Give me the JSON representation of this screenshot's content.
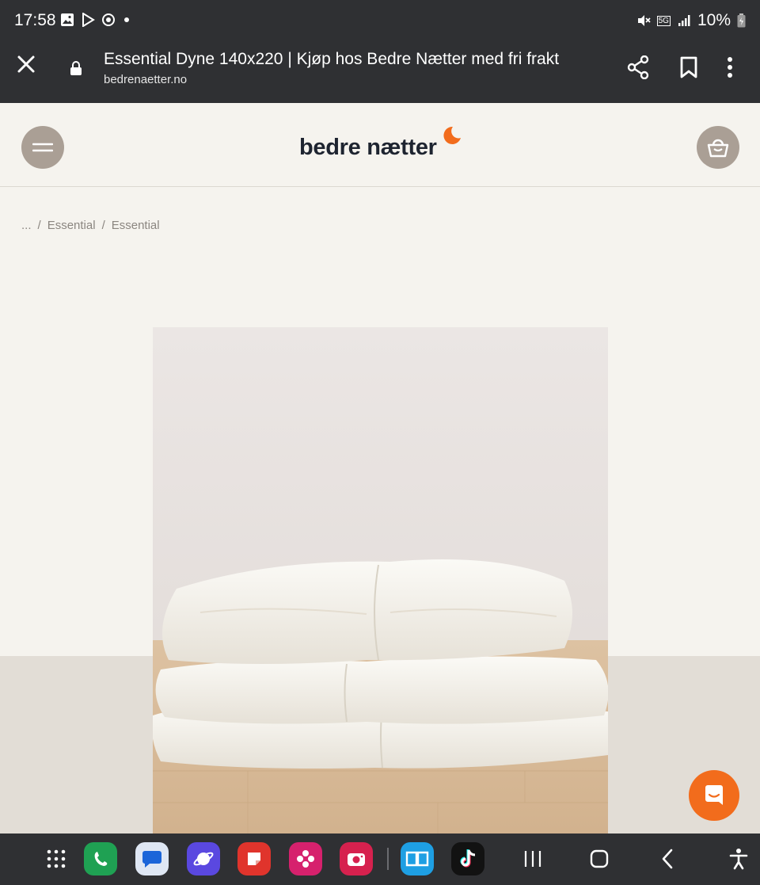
{
  "status_bar": {
    "time": "17:58",
    "battery": "10%",
    "network": "5G"
  },
  "browser": {
    "title": "Essential Dyne 140x220 | Kjøp hos Bedre Nætter med fri frakt",
    "domain": "bedrenaetter.no"
  },
  "site": {
    "logo_text": "bedre nætter",
    "accent_color": "#f26c1c",
    "button_color": "#aa9f95"
  },
  "breadcrumb": {
    "items": [
      "...",
      "Essential",
      "Essential"
    ],
    "separator": "/"
  },
  "product": {
    "image_alt": "white duvet folded"
  },
  "icons": {
    "close": "close-icon",
    "lock": "lock-icon",
    "share": "share-icon",
    "bookmark": "bookmark-icon",
    "more": "more-vertical-icon",
    "menu": "hamburger-menu-icon",
    "cart": "shopping-basket-icon",
    "chat": "chat-icon"
  },
  "taskbar": {
    "apps": [
      "app-drawer",
      "phone",
      "messages",
      "internet",
      "notes",
      "gallery",
      "camera",
      "reader",
      "tiktok"
    ],
    "nav": [
      "recents",
      "home",
      "back",
      "accessibility"
    ]
  }
}
